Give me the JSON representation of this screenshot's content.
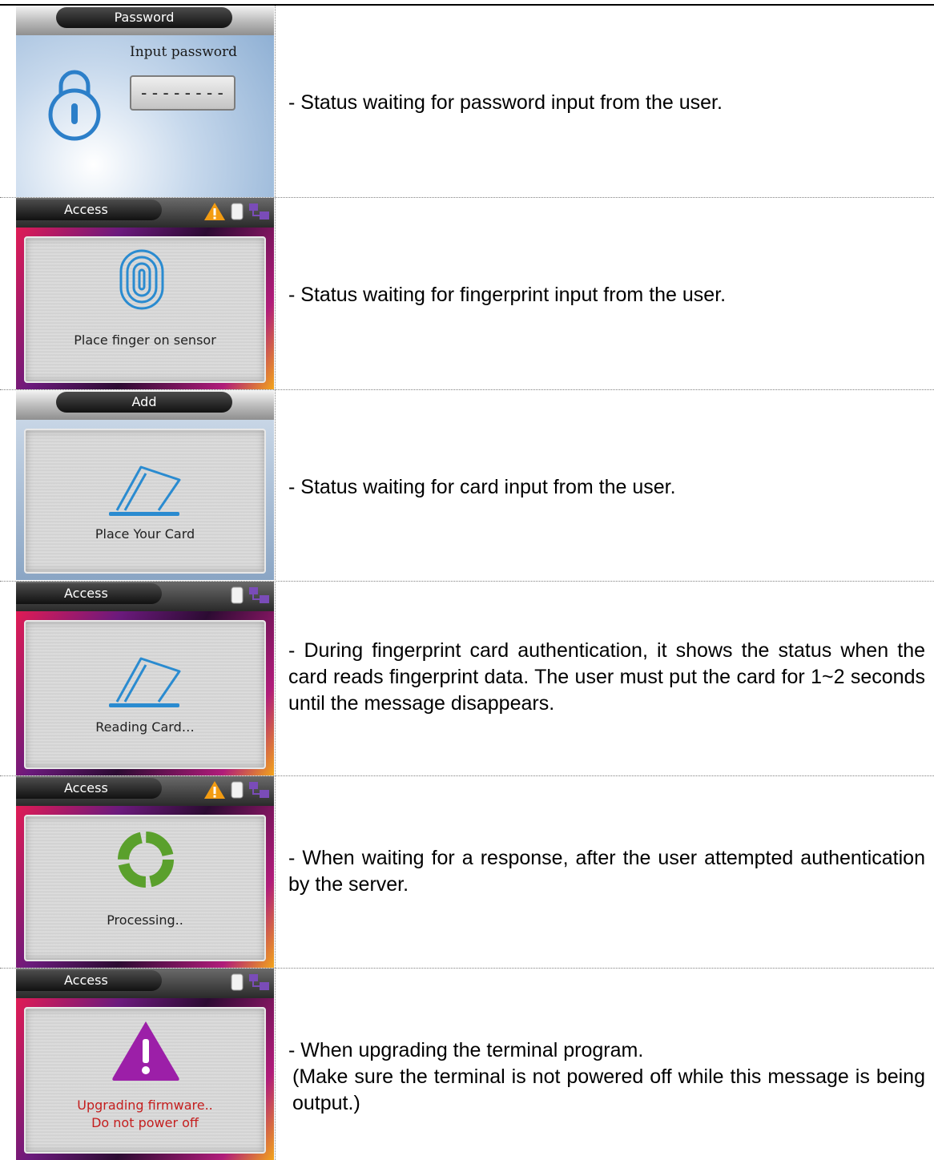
{
  "rows": [
    {
      "screen": {
        "title": "Password",
        "label": "Input password",
        "field_value": "--------",
        "icons": [
          "lock-icon"
        ]
      },
      "description": [
        "- Status waiting for password input from the user."
      ]
    },
    {
      "screen": {
        "title": "Access",
        "message": "Place finger on sensor",
        "icons": [
          "warning-icon",
          "card-status-icon",
          "network-icon",
          "fingerprint-icon"
        ]
      },
      "description": [
        "- Status waiting for fingerprint input from the user."
      ]
    },
    {
      "screen": {
        "title": "Add",
        "message": "Place Your Card",
        "icons": [
          "card-icon"
        ]
      },
      "description": [
        "- Status waiting for card input from the user."
      ]
    },
    {
      "screen": {
        "title": "Access",
        "message": "Reading Card…",
        "icons": [
          "card-status-icon",
          "network-icon",
          "card-icon"
        ]
      },
      "description": [
        "- During fingerprint card authentication, it shows the status when the card reads fingerprint data. The user must put the card for 1~2 seconds until the message disappears."
      ]
    },
    {
      "screen": {
        "title": "Access",
        "message": "Processing..",
        "icons": [
          "warning-icon",
          "card-status-icon",
          "network-icon",
          "processing-icon"
        ]
      },
      "description": [
        "- When waiting for a response, after the user attempted authentication by the server."
      ]
    },
    {
      "screen": {
        "title": "Access",
        "message_line1": "Upgrading firmware..",
        "message_line2": "Do not power off",
        "icons": [
          "card-status-icon",
          "network-icon",
          "alert-triangle-icon"
        ]
      },
      "description": [
        "- When upgrading the terminal program.",
        "(Make sure the terminal is not powered off while this message is being output.)"
      ]
    }
  ],
  "colors": {
    "text": "#000000",
    "alert_text": "#c41e1e",
    "divider": "#808080"
  }
}
